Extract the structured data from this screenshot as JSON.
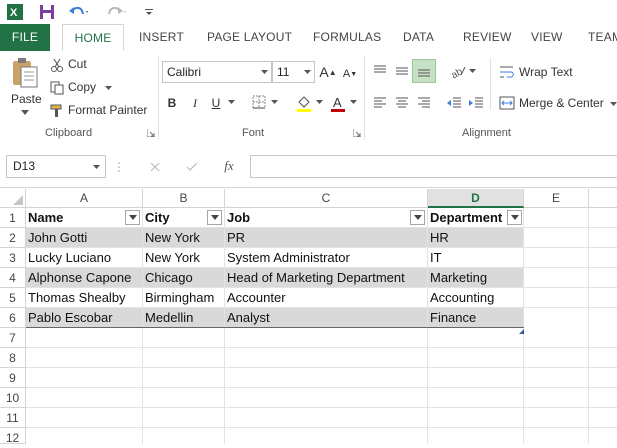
{
  "qat": {
    "app_icon": "excel-icon",
    "save_icon": "save-icon",
    "undo_icon": "undo-icon",
    "redo_icon": "redo-icon",
    "customize_icon": "customize-qat-icon"
  },
  "tabs": [
    "FILE",
    "HOME",
    "INSERT",
    "PAGE LAYOUT",
    "FORMULAS",
    "DATA",
    "REVIEW",
    "VIEW",
    "TEAM"
  ],
  "ribbon": {
    "clipboard": {
      "paste": "Paste",
      "cut": "Cut",
      "copy": "Copy",
      "format_painter": "Format Painter",
      "label": "Clipboard"
    },
    "font": {
      "family": "Calibri",
      "size": "11",
      "bold": "B",
      "italic": "I",
      "underline": "U",
      "grow": "A",
      "shrink": "A",
      "label": "Font"
    },
    "alignment": {
      "wrap_text": "Wrap Text",
      "merge_center": "Merge & Center",
      "label": "Alignment"
    }
  },
  "formula_bar": {
    "name_box": "D13",
    "fx": "fx",
    "value": ""
  },
  "columns": [
    "A",
    "B",
    "C",
    "D",
    "E"
  ],
  "rows": [
    "1",
    "2",
    "3",
    "4",
    "5",
    "6",
    "7",
    "8",
    "9",
    "10",
    "11",
    "12"
  ],
  "table": {
    "headers": [
      "Name",
      "City",
      "Job",
      "Department"
    ],
    "rows": [
      [
        "John Gotti",
        "New York",
        "PR",
        "HR"
      ],
      [
        "Lucky Luciano",
        "New York",
        "System Administrator",
        "IT"
      ],
      [
        "Alphonse Capone",
        "Chicago",
        "Head of Marketing Department",
        "Marketing"
      ],
      [
        "Thomas Shealby",
        "Birmingham",
        "Accounter",
        "Accounting"
      ],
      [
        "Pablo Escobar",
        "Medellin",
        "Analyst",
        "Finance"
      ]
    ]
  },
  "colors": {
    "accent": "#217346",
    "band": "#d9d9d9",
    "font_color": "#c00000"
  }
}
